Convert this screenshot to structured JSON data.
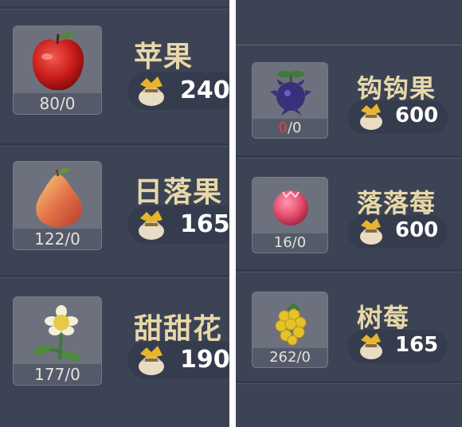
{
  "left_column": [
    {
      "name": "苹果",
      "count": "80/0",
      "price": "240",
      "icon": "apple-icon"
    },
    {
      "name": "日落果",
      "count": "122/0",
      "price": "165",
      "icon": "sunsettia-icon"
    },
    {
      "name": "甜甜花",
      "count": "177/0",
      "price": "190",
      "icon": "sweet-flower-icon"
    }
  ],
  "right_column": [
    {
      "name": "钩钩果",
      "count_red": "0",
      "count_rest": "/0",
      "price": "600",
      "icon": "wolfhook-icon"
    },
    {
      "name": "落落莓",
      "count": "16/0",
      "price": "600",
      "icon": "valberry-icon"
    },
    {
      "name": "树莓",
      "count": "262/0",
      "price": "165",
      "icon": "raspberry-icon"
    }
  ],
  "currency_icon": "coin-bag-icon",
  "colors": {
    "name_text": "#e8d8a8",
    "count_zero_red": "#e0453a",
    "panel_bg": "#3c4355"
  }
}
